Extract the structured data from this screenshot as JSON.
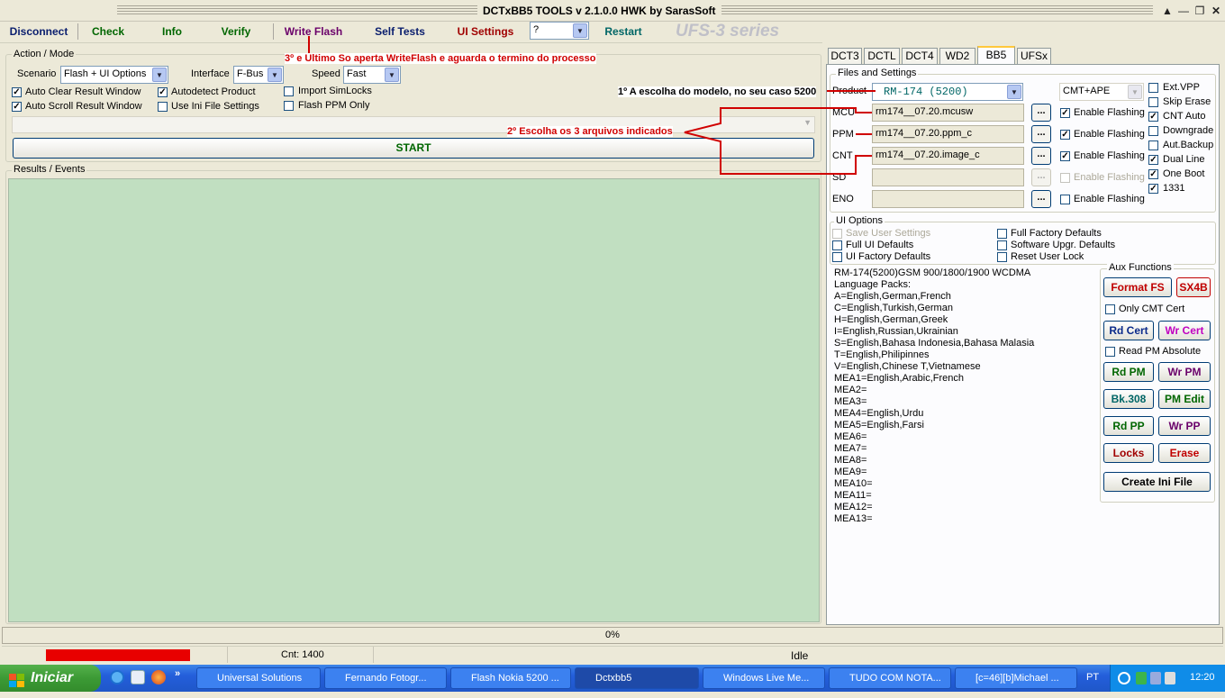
{
  "window": {
    "title": "DCTxBB5 TOOLS v 2.1.0.0 HWK by SarasSoft"
  },
  "toolbar": {
    "disconnect": "Disconnect",
    "check": "Check",
    "info": "Info",
    "verify": "Verify",
    "write_flash": "Write Flash",
    "self_tests": "Self Tests",
    "ui_settings": "UI Settings",
    "combo_value": "?",
    "restart": "Restart",
    "series": "UFS-3  series"
  },
  "annotations": {
    "a1": "3º e Ultimo So aperta WriteFlash e aguarda o termino do processo",
    "a2": "1º A escolha do modelo, no seu caso 5200",
    "a3": "2º Escolha os 3 arquivos indicados"
  },
  "action_mode": {
    "title": "Action / Mode",
    "scenario_label": "Scenario",
    "scenario_value": "Flash + UI Options",
    "interface_label": "Interface",
    "interface_value": "F-Bus",
    "speed_label": "Speed",
    "speed_value": "Fast",
    "auto_clear": "Auto Clear Result Window",
    "auto_scroll": "Auto Scroll Result Window",
    "autodetect": "Autodetect Product",
    "use_ini": "Use Ini File Settings",
    "import_simlocks": "Import SimLocks",
    "flash_ppm_only": "Flash PPM Only",
    "start": "START"
  },
  "results": {
    "title": "Results / Events"
  },
  "tabs": [
    "DCT3",
    "DCTL",
    "DCT4",
    "WD2",
    "BB5",
    "UFSx"
  ],
  "files": {
    "title": "Files and Settings",
    "product_label": "Product",
    "product_value": "RM-174  (5200)",
    "cmt_value": "CMT+APE",
    "mcu_label": "MCU",
    "mcu_value": "rm174__07.20.mcusw",
    "ppm_label": "PPM",
    "ppm_value": "rm174__07.20.ppm_c",
    "cnt_label": "CNT",
    "cnt_value": "rm174__07.20.image_c",
    "sd_label": "SD",
    "sd_value": "",
    "eno_label": "ENO",
    "eno_value": "",
    "enable_flashing": "Enable Flashing",
    "browse": "..."
  },
  "right_options": [
    "Ext.VPP",
    "Skip Erase",
    "CNT Auto",
    "Downgrade",
    "Aut.Backup",
    "Dual Line",
    "One Boot",
    "1331"
  ],
  "ui_options": {
    "title": "UI Options",
    "save_user": "Save User Settings",
    "full_ui": "Full UI Defaults",
    "ui_factory": "UI Factory Defaults",
    "full_factory": "Full Factory Defaults",
    "software_upgr": "Software Upgr. Defaults",
    "reset_user_lock": "Reset User Lock"
  },
  "info_lines": [
    "RM-174(5200)GSM 900/1800/1900   WCDMA",
    "Language Packs:",
    "A=English,German,French",
    "C=English,Turkish,German",
    "H=English,German,Greek",
    "I=English,Russian,Ukrainian",
    "S=English,Bahasa Indonesia,Bahasa Malasia",
    "T=English,Philipinnes",
    "V=English,Chinese T,Vietnamese",
    "MEA1=English,Arabic,French",
    "MEA2=",
    "MEA3=",
    "MEA4=English,Urdu",
    "MEA5=English,Farsi",
    "MEA6=",
    "MEA7=",
    "MEA8=",
    "MEA9=",
    "MEA10=",
    "MEA11=",
    "MEA12=",
    "MEA13="
  ],
  "aux": {
    "title": "Aux Functions",
    "format_fs": "Format FS",
    "sx4b": "SX4B",
    "only_cmt": "Only CMT Cert",
    "rd_cert": "Rd Cert",
    "wr_cert": "Wr Cert",
    "read_pm_abs": "Read PM Absolute",
    "rd_pm": "Rd PM",
    "wr_pm": "Wr PM",
    "bk308": "Bk.308",
    "pm_edit": "PM Edit",
    "rd_pp": "Rd PP",
    "wr_pp": "Wr PP",
    "locks": "Locks",
    "erase": "Erase",
    "create_ini": "Create Ini File"
  },
  "status": {
    "progress": "0%",
    "cnt": "Cnt: 1400",
    "state": "Idle"
  },
  "taskbar": {
    "start": "Iniciar",
    "items": [
      "Universal Solutions",
      "Fernando Fotogr...",
      "Flash Nokia 5200 ...",
      "Dctxbb5",
      "Windows Live Me...",
      "TUDO COM NOTA...",
      "[c=46][b]Michael ..."
    ],
    "lang": "PT",
    "time": "12:20"
  },
  "colors": {
    "results_bg": "#c1dfc1",
    "progress_red": "#e80000",
    "annot_red": "#d00000"
  }
}
